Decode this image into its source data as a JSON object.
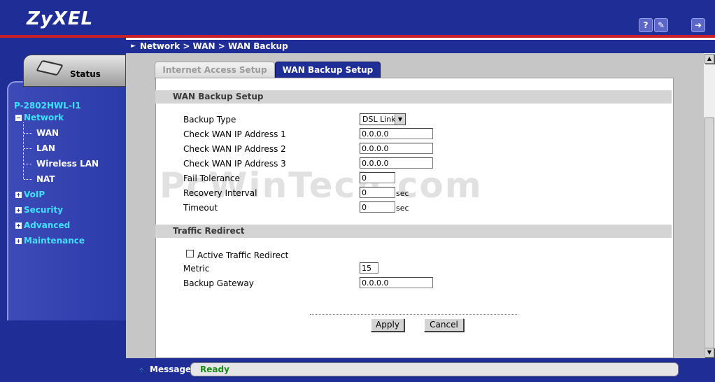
{
  "brand": {
    "logo": "ZyXEL"
  },
  "header": {
    "help_icon": "question-icon",
    "wizard_icon": "wand-icon",
    "logout_icon": "logout-icon"
  },
  "sidebar": {
    "status_label": "Status",
    "model": "P-2802HWL-I1",
    "network_label": "Network",
    "network_children": [
      "WAN",
      "LAN",
      "Wireless LAN",
      "NAT"
    ],
    "voip_label": "VoIP",
    "security_label": "Security",
    "advanced_label": "Advanced",
    "maintenance_label": "Maintenance"
  },
  "breadcrumb": "Network > WAN > WAN Backup",
  "tabs": {
    "internet_access": "Internet Access Setup",
    "wan_backup": "WAN Backup Setup"
  },
  "wan_backup": {
    "section_title": "WAN Backup Setup",
    "backup_type_label": "Backup Type",
    "backup_type_value": "DSL Link",
    "check_ip1_label": "Check WAN IP Address  1",
    "check_ip1_value": "0.0.0.0",
    "check_ip2_label": "Check WAN IP Address  2",
    "check_ip2_value": "0.0.0.0",
    "check_ip3_label": "Check WAN IP Address  3",
    "check_ip3_value": "0.0.0.0",
    "fail_tolerance_label": "Fail Tolerance",
    "fail_tolerance_value": "0",
    "recovery_interval_label": "Recovery Interval",
    "recovery_interval_value": "0",
    "timeout_label": "Timeout",
    "timeout_value": "0",
    "unit_sec": "sec"
  },
  "traffic_redirect": {
    "section_title": "Traffic Redirect",
    "active_label": "Active Traffic Redirect",
    "active_checked": false,
    "metric_label": "Metric",
    "metric_value": "15",
    "backup_gateway_label": "Backup Gateway",
    "backup_gateway_value": "0.0.0.0"
  },
  "buttons": {
    "apply": "Apply",
    "cancel": "Cancel"
  },
  "footer": {
    "message_label": "Message",
    "status": "Ready"
  },
  "watermark": "PcWinTech.com"
}
